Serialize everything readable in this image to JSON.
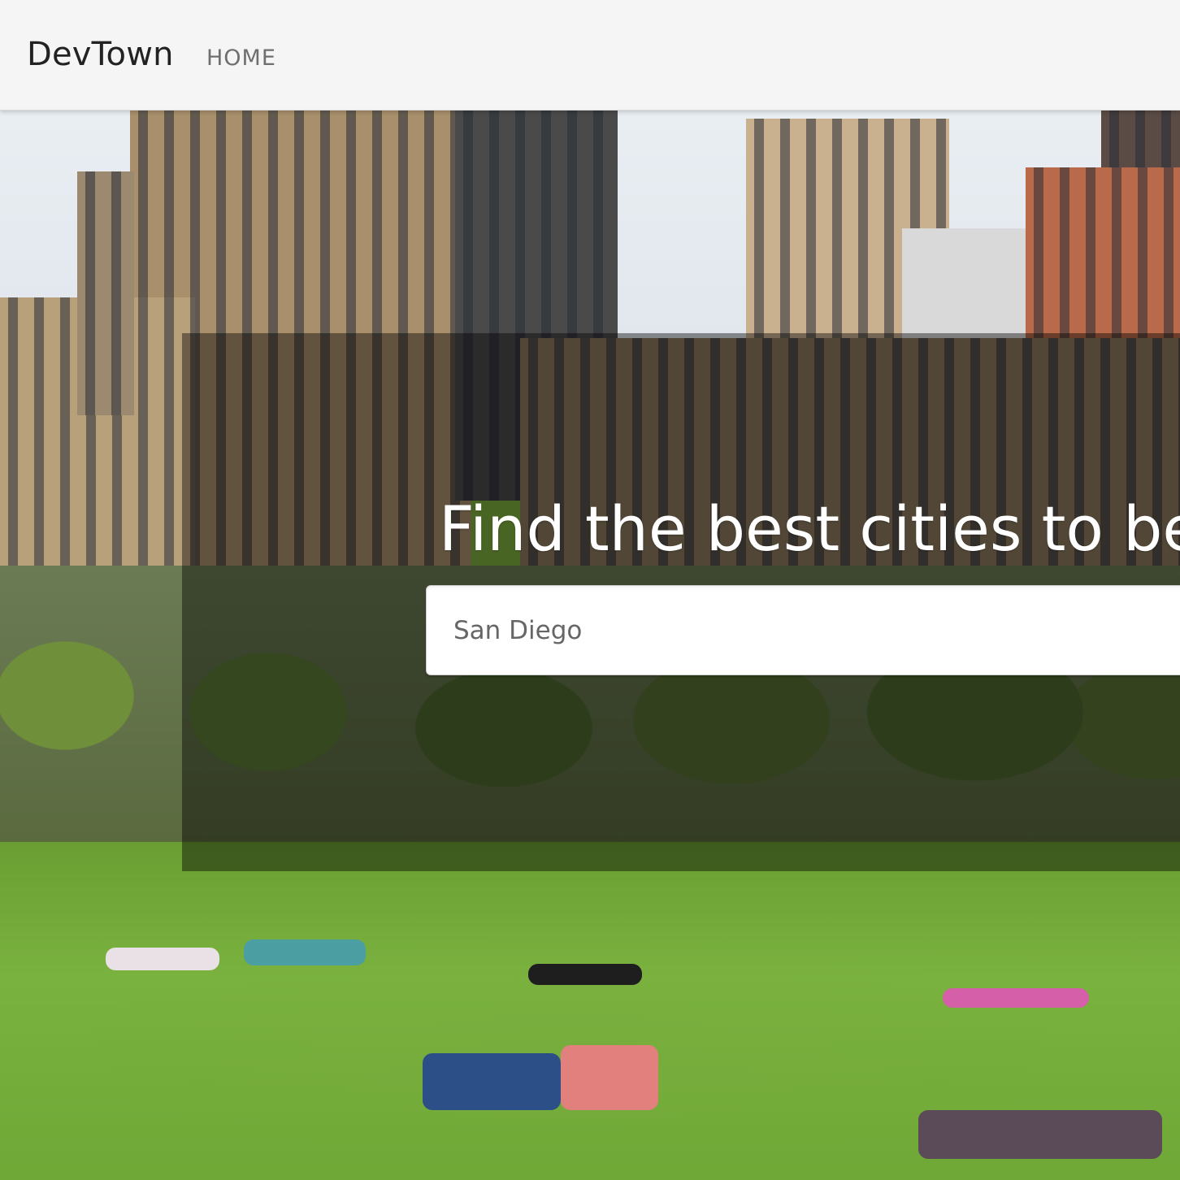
{
  "navbar": {
    "brand": "DevTown",
    "links": [
      {
        "label": "HOME"
      }
    ]
  },
  "hero": {
    "heading": "Find the best cities to be a",
    "search": {
      "placeholder": "San Diego",
      "value": ""
    }
  },
  "colors": {
    "navbar_bg": "#f5f5f5",
    "overlay": "rgba(0,0,0,0.42)",
    "heading": "#ffffff"
  }
}
